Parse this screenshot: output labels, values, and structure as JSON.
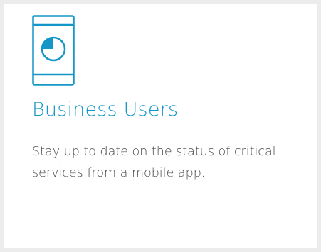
{
  "card": {
    "icon": "mobile-phone-pie-chart-icon",
    "accent_color": "#1496c7",
    "title": "Business Users",
    "description": "Stay up to date on the status of critical services from a mobile app."
  }
}
